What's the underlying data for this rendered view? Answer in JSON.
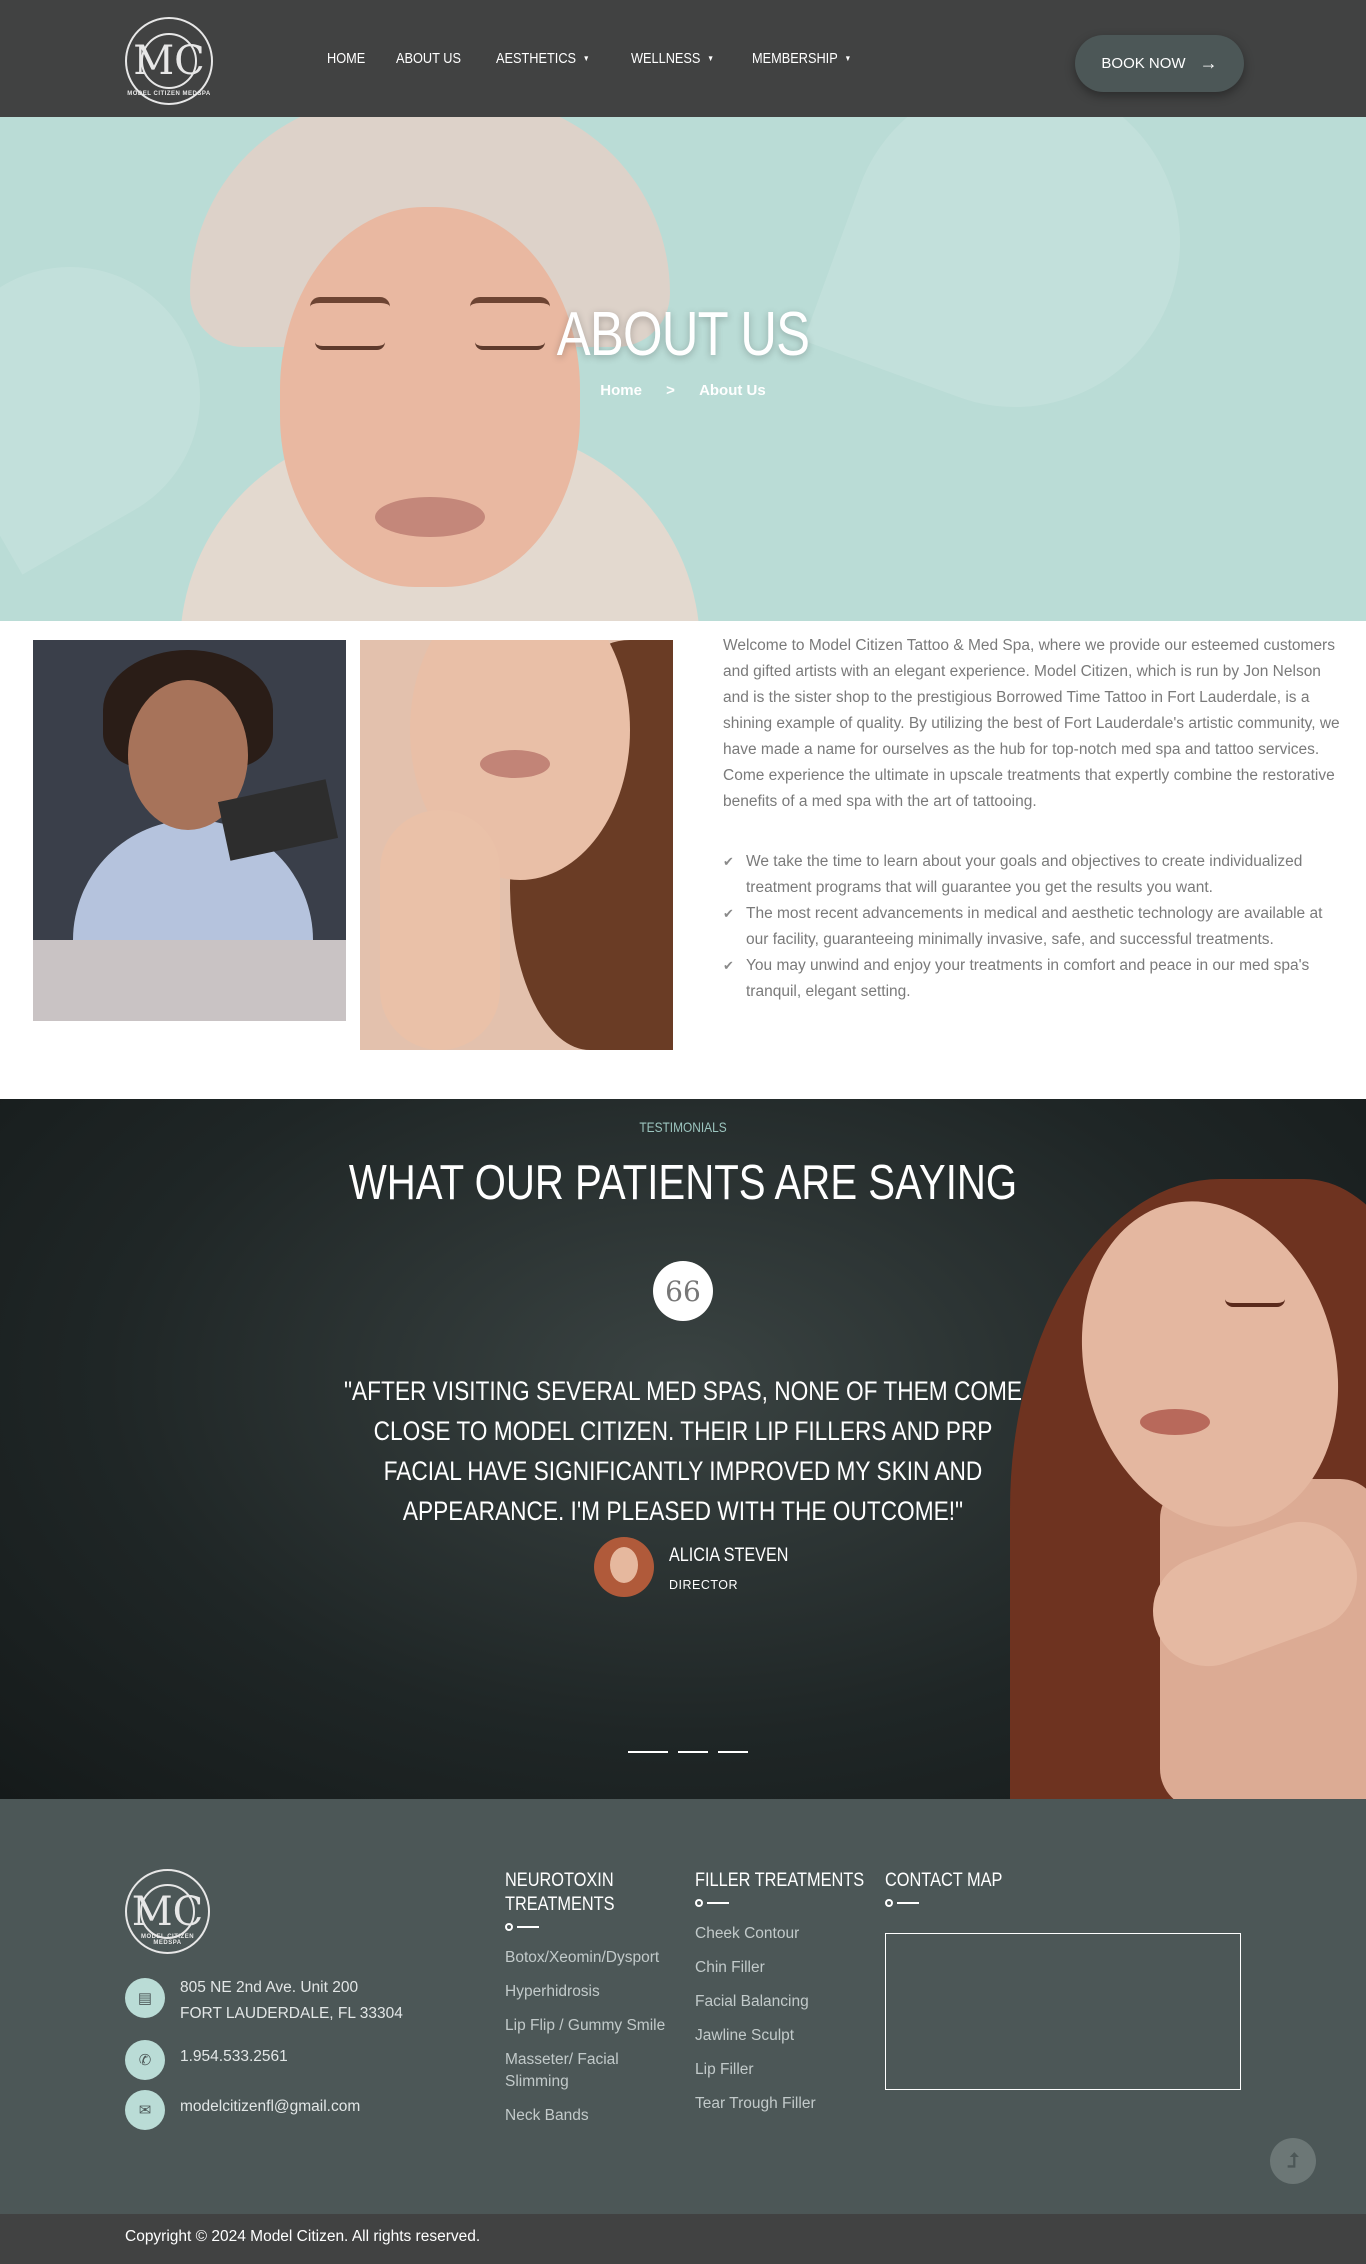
{
  "header": {
    "logo_text": "MODEL CITIZEN MEDSPA",
    "logo_mark": "MC",
    "nav": [
      {
        "label": "HOME",
        "has_dropdown": false
      },
      {
        "label": "ABOUT US",
        "has_dropdown": false
      },
      {
        "label": "AESTHETICS",
        "has_dropdown": true
      },
      {
        "label": "WELLNESS",
        "has_dropdown": true
      },
      {
        "label": "MEMBERSHIP",
        "has_dropdown": true
      }
    ],
    "book_label": "BOOK NOW",
    "book_icon": "arrow-right-icon"
  },
  "hero": {
    "title": "ABOUT US",
    "breadcrumb": {
      "home": "Home",
      "separator": ">",
      "current": "About Us"
    }
  },
  "about": {
    "intro": "Welcome to Model Citizen Tattoo & Med Spa, where we provide our esteemed customers and gifted artists with an elegant experience. Model Citizen, which is run by Jon Nelson and is the sister shop to the prestigious Borrowed Time Tattoo in Fort Lauderdale, is a shining example of quality. By utilizing the best of Fort Lauderdale's artistic community, we have made a name for ourselves as the hub for top-notch med spa and tattoo services. Come experience the ultimate in upscale treatments that expertly combine the restorative benefits of a med spa with the art of tattooing.",
    "points": [
      "We take the time to learn about your goals and objectives to create individualized treatment programs that will guarantee you get the results you want.",
      "The most recent advancements in medical and aesthetic technology are available at our facility, guaranteeing minimally invasive, safe, and successful treatments.",
      "You may unwind and enjoy your treatments in comfort and peace in our med spa's tranquil, elegant setting."
    ]
  },
  "testimonials": {
    "eyebrow": "TESTIMONIALS",
    "title": "WHAT OUR PATIENTS ARE SAYING",
    "quote_icon": "quote-icon",
    "quote_glyph": "66",
    "quote": "\"AFTER VISITING SEVERAL MED SPAS, NONE OF THEM COME CLOSE TO MODEL CITIZEN. THEIR LIP FILLERS AND PRP FACIAL HAVE SIGNIFICANTLY IMPROVED MY SKIN AND APPEARANCE. I'M PLEASED WITH THE OUTCOME!\"",
    "author": "ALICIA STEVEN",
    "role": "DIRECTOR",
    "slide_count": 3
  },
  "footer": {
    "address_line1": "805 NE 2nd Ave. Unit 200",
    "address_line2": "FORT LAUDERDALE, FL 33304",
    "phone": "1.954.533.2561",
    "email": "modelcitizenfl@gmail.com",
    "col1": {
      "title_line1": "NEUROTOXIN",
      "title_line2": "TREATMENTS",
      "links": [
        "Botox/Xeomin/Dysport",
        "Hyperhidrosis",
        "Lip Flip / Gummy Smile",
        "Masseter/ Facial Slimming",
        "Neck Bands"
      ]
    },
    "col2": {
      "title": "FILLER TREATMENTS",
      "links": [
        "Cheek Contour",
        "Chin Filler",
        "Facial Balancing",
        "Jawline Sculpt",
        "Lip Filler",
        "Tear Trough Filler"
      ]
    },
    "col3": {
      "title": "CONTACT MAP"
    },
    "copyright": "Copyright © 2024 Model Citizen. All rights reserved."
  },
  "colors": {
    "header_bg": "#414242",
    "hero_bg": "#badcd6",
    "accent": "#badcd6",
    "footer_bg": "#4c5757",
    "button_bg": "#4c5757"
  }
}
